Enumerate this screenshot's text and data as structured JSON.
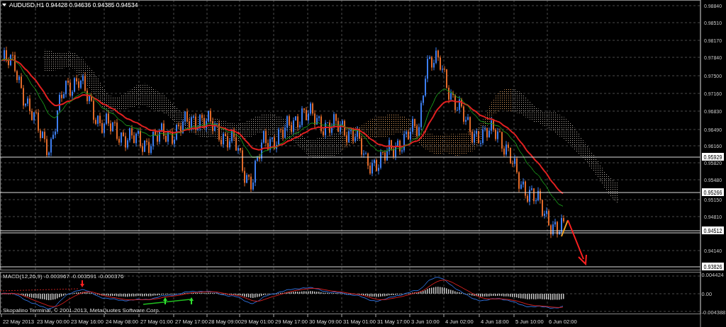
{
  "chart_title": "AUDUSD,H1 0.94428 0.94636 0.94385 0.94534",
  "price_axis": {
    "labels": [
      "0.98840",
      "0.98510",
      "0.98170",
      "0.97840",
      "0.97500",
      "0.97160",
      "0.96830",
      "0.96490",
      "0.96160",
      "0.95820",
      "0.95480",
      "0.95150",
      "0.94810",
      "0.94140"
    ],
    "levels": [
      "0.95929",
      "0.95266",
      "0.94512",
      "0.93826"
    ]
  },
  "macd_panel": {
    "label": "MACD(12,26,9) -0.003967 -0.003591 -0.000376",
    "axis_labels": [
      "0.004424",
      "0.00",
      "-0.004388"
    ]
  },
  "copyright": "Skopalino Terminal, © 2001-2013, MetaQuotes Software Corp.",
  "time_axis": {
    "labels": [
      "22 May 2013",
      "23 May 00:00",
      "23 May 16:00",
      "24 May 08:00",
      "27 May 01:00",
      "27 May 17:00",
      "28 May 09:00",
      "29 May 01:00",
      "29 May 17:00",
      "30 May 09:00",
      "31 May 01:00",
      "31 May 17:00",
      "3 Jun 10:00",
      "4 Jun 02:00",
      "4 Jun 18:00",
      "5 Jun 10:00",
      "6 Jun 02:00"
    ]
  }
}
